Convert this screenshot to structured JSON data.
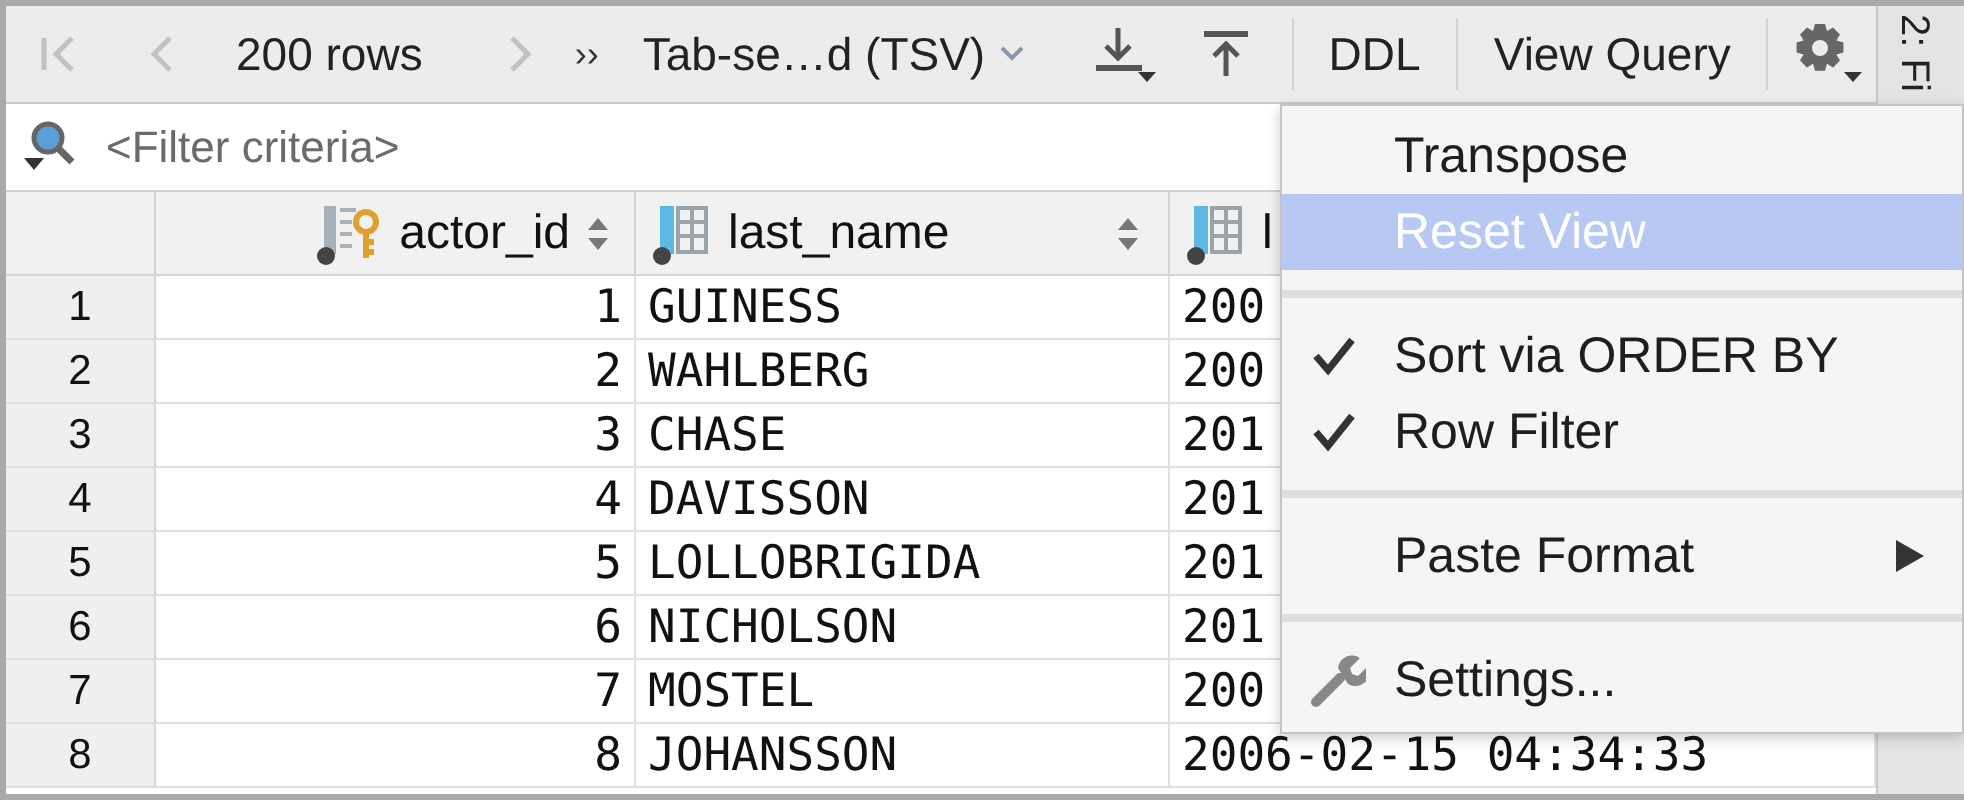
{
  "toolbar": [
    {
      "kind": "first",
      "disabled": true
    },
    {
      "kind": "prev",
      "disabled": true
    },
    {
      "kind": "count",
      "label": "200 rows"
    },
    {
      "kind": "next",
      "disabled": true
    },
    {
      "kind": "more",
      "label": "››"
    },
    {
      "kind": "format",
      "label": "Tab-se…d (TSV)"
    },
    {
      "kind": "download"
    },
    {
      "kind": "upload"
    },
    {
      "kind": "button",
      "label": "DDL"
    },
    {
      "kind": "button",
      "label": "View Query"
    },
    {
      "kind": "settings"
    }
  ],
  "side_strip": {
    "label": "2: Fi"
  },
  "filter": {
    "placeholder": "<Filter criteria>"
  },
  "table": {
    "columns": [
      {
        "label": "actor_id",
        "kind": "key",
        "sortable": true
      },
      {
        "label": "last_name",
        "kind": "column",
        "sortable": true
      },
      {
        "label": "l",
        "kind": "column"
      }
    ],
    "rows": [
      {
        "number": "1",
        "cells": [
          "1",
          "GUINESS",
          "200"
        ]
      },
      {
        "number": "2",
        "cells": [
          "2",
          "WAHLBERG",
          "200"
        ]
      },
      {
        "number": "3",
        "cells": [
          "3",
          "CHASE",
          "201"
        ]
      },
      {
        "number": "4",
        "cells": [
          "4",
          "DAVISSON",
          "201"
        ]
      },
      {
        "number": "5",
        "cells": [
          "5",
          "LOLLOBRIGIDA",
          "201"
        ]
      },
      {
        "number": "6",
        "cells": [
          "6",
          "NICHOLSON",
          "201"
        ]
      },
      {
        "number": "7",
        "cells": [
          "7",
          "MOSTEL",
          "200"
        ]
      },
      {
        "number": "8",
        "cells": [
          "8",
          "JOHANSSON",
          "2006-02-15 04:34:33"
        ]
      }
    ]
  },
  "menu": {
    "items": [
      {
        "kind": "item",
        "label": "Transpose",
        "selected": false,
        "checked": false
      },
      {
        "kind": "item",
        "label": "Reset View",
        "selected": true,
        "checked": false
      },
      {
        "kind": "separator"
      },
      {
        "kind": "item",
        "label": "Sort via ORDER BY",
        "selected": false,
        "checked": true
      },
      {
        "kind": "item",
        "label": "Row Filter",
        "selected": false,
        "checked": true
      },
      {
        "kind": "separator"
      },
      {
        "kind": "submenu",
        "label": "Paste Format",
        "selected": false,
        "checked": false
      },
      {
        "kind": "separator"
      },
      {
        "kind": "settings",
        "label": "Settings...",
        "selected": false,
        "checked": false
      }
    ]
  }
}
